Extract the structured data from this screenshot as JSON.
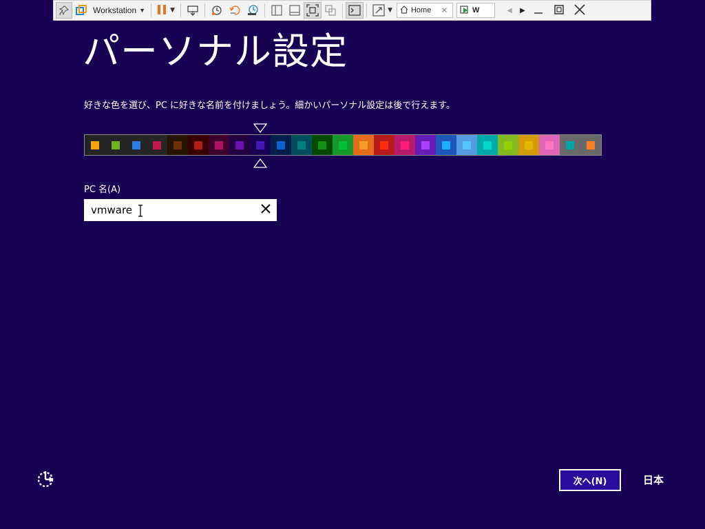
{
  "vmware_toolbar": {
    "vm_menu_label": "Workstation",
    "tabs": [
      {
        "label": "Home",
        "icon": "home-icon"
      },
      {
        "label": "W",
        "icon": "vm-play-icon"
      }
    ]
  },
  "page": {
    "title": "パーソナル設定",
    "description": "好きな色を選び、PC に好きな名前を付けましょう。細かいパーソナル設定は後で行えます。",
    "pc_name_label": "PC 名(A)",
    "pc_name_value": "vmware",
    "next_button_label": "次へ(N)",
    "language_label": "日本"
  },
  "color_swatches": {
    "selected_index": 8,
    "colors": [
      {
        "bg": "#252525",
        "chip": "#f5a30a"
      },
      {
        "bg": "#252525",
        "chip": "#6fb51d"
      },
      {
        "bg": "#252525",
        "chip": "#2f7be2"
      },
      {
        "bg": "#252525",
        "chip": "#c0184d"
      },
      {
        "bg": "#261300",
        "chip": "#6b3105"
      },
      {
        "bg": "#380000",
        "chip": "#b01e12"
      },
      {
        "bg": "#40002e",
        "chip": "#b0125f"
      },
      {
        "bg": "#250040",
        "chip": "#6e0fb4"
      },
      {
        "bg": "#180053",
        "chip": "#4617b4"
      },
      {
        "bg": "#001e4e",
        "chip": "#0a63c9"
      },
      {
        "bg": "#004d60",
        "chip": "#008080"
      },
      {
        "bg": "#004a00",
        "chip": "#139010"
      },
      {
        "bg": "#15992a",
        "chip": "#00c038"
      },
      {
        "bg": "#e56c19",
        "chip": "#ff9a2e"
      },
      {
        "bg": "#b81b1b",
        "chip": "#ff2e12"
      },
      {
        "bg": "#b81b6c",
        "chip": "#ff1d77"
      },
      {
        "bg": "#691bb8",
        "chip": "#aa40ff"
      },
      {
        "bg": "#1b58b8",
        "chip": "#1faeff"
      },
      {
        "bg": "#569ce3",
        "chip": "#56c5ff"
      },
      {
        "bg": "#00aaaa",
        "chip": "#00d8cc"
      },
      {
        "bg": "#83ba1f",
        "chip": "#91d100"
      },
      {
        "bg": "#d39d09",
        "chip": "#e1b700"
      },
      {
        "bg": "#e064b7",
        "chip": "#ff76bc"
      },
      {
        "bg": "#696969",
        "chip": "#00a4a4"
      },
      {
        "bg": "#696969",
        "chip": "#ff7d23"
      }
    ]
  },
  "colors": {
    "background": "#180053",
    "next_button_bg": "#2a0d9c"
  }
}
